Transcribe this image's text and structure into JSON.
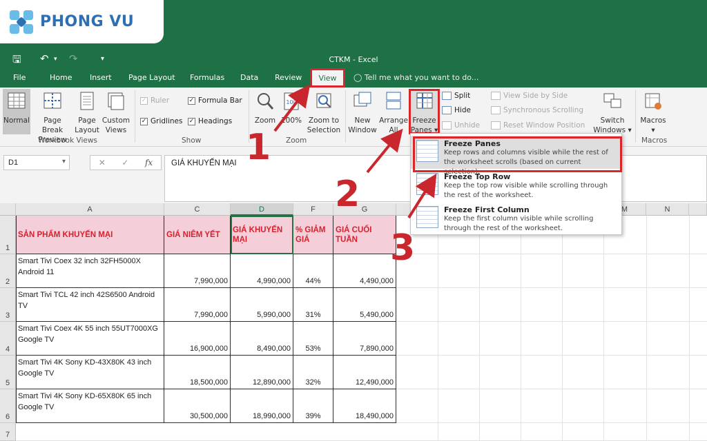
{
  "brand": {
    "logo_text": "PHONG VU",
    "logo_color": "#2d6fb5"
  },
  "window": {
    "title": "CTKM - Excel"
  },
  "tabs": [
    "File",
    "Home",
    "Insert",
    "Page Layout",
    "Formulas",
    "Data",
    "Review",
    "View"
  ],
  "tell_me": "Tell me what you want to do...",
  "ribbon": {
    "workbook_views": {
      "label": "Workbook Views",
      "normal": "Normal",
      "page_break_1": "Page Break",
      "page_break_2": "Preview",
      "page_layout_1": "Page",
      "page_layout_2": "Layout",
      "custom_1": "Custom",
      "custom_2": "Views"
    },
    "show": {
      "label": "Show",
      "ruler": "Ruler",
      "formula_bar": "Formula Bar",
      "gridlines": "Gridlines",
      "headings": "Headings"
    },
    "zoom": {
      "label": "Zoom",
      "zoom": "Zoom",
      "hundred": "100%",
      "zoom_sel_1": "Zoom to",
      "zoom_sel_2": "Selection"
    },
    "window": {
      "new_1": "New",
      "new_2": "Window",
      "arrange_1": "Arrange",
      "arrange_2": "All",
      "freeze_1": "Freeze",
      "freeze_2": "Panes ▾",
      "split": "Split",
      "hide": "Hide",
      "unhide": "Unhide",
      "side_by_side": "View Side by Side",
      "sync_scroll": "Synchronous Scrolling",
      "reset_pos": "Reset Window Position",
      "switch_1": "Switch",
      "switch_2": "Windows ▾"
    },
    "macros": {
      "label": "Macros",
      "button": "Macros",
      "arrow": "▾"
    }
  },
  "namebox": "D1",
  "formula": "GIÁ KHUYẾN MẠI",
  "columns": [
    "A",
    "C",
    "D",
    "F",
    "G",
    "M",
    "N"
  ],
  "rows": [
    "1",
    "2",
    "3",
    "4",
    "5",
    "6",
    "7"
  ],
  "table": {
    "headers": [
      "SẢN PHẨM KHUYẾN MẠI",
      "GIÁ NIÊM YẾT",
      "GIÁ KHUYẾN MẠI",
      "% GIẢM GIÁ",
      "GIÁ CUỐI TUẦN"
    ],
    "rows": [
      [
        "Smart Tivi Coex 32 inch 32FH5000X Android 11",
        "7,990,000",
        "4,990,000",
        "44%",
        "4,490,000"
      ],
      [
        "Smart Tivi TCL 42 inch 42S6500 Android TV",
        "7,990,000",
        "5,990,000",
        "31%",
        "5,490,000"
      ],
      [
        "Smart Tivi Coex 4K 55 inch 55UT7000XG Google TV",
        "16,900,000",
        "8,490,000",
        "53%",
        "7,890,000"
      ],
      [
        "Smart Tivi 4K Sony KD-43X80K 43 inch Google TV",
        "18,500,000",
        "12,890,000",
        "32%",
        "12,490,000"
      ],
      [
        "Smart Tivi 4K Sony KD-65X80K 65 inch Google TV",
        "30,500,000",
        "18,990,000",
        "39%",
        "18,490,000"
      ]
    ]
  },
  "freeze_menu": [
    {
      "title": "Freeze Panes",
      "desc": "Keep rows and columns visible while the rest of the worksheet scrolls (based on current selection)."
    },
    {
      "title": "Freeze Top Row",
      "desc": "Keep the top row visible while scrolling through the rest of the worksheet."
    },
    {
      "title": "Freeze First Column",
      "desc": "Keep the first column visible while scrolling through the rest of the worksheet."
    }
  ],
  "steps": [
    "1",
    "2",
    "3"
  ],
  "colors": {
    "excel_green": "#1e7145",
    "highlight_red": "#d9262a",
    "header_fill": "#f4cfd9",
    "header_text": "#d91f2c"
  }
}
